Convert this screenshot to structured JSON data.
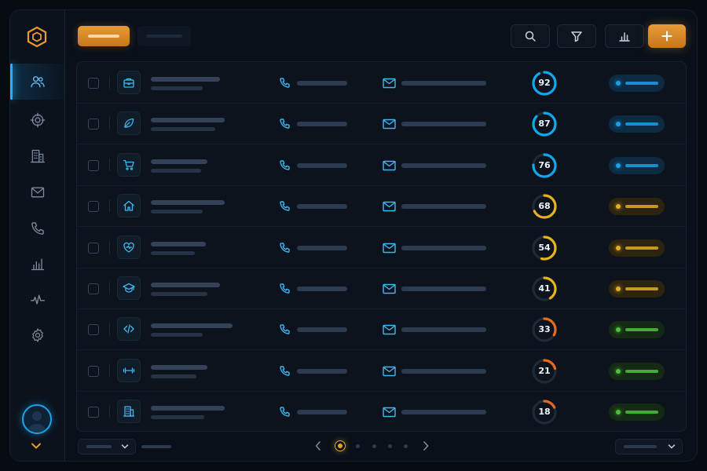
{
  "theme": {
    "accent_blue": "#22b0ff",
    "accent_orange": "#e79a34",
    "score_blue": "#12a6ec",
    "score_yellow": "#e8b21f",
    "score_orange": "#ea6a1c",
    "status_blue": "#1e9fe6",
    "status_yellow": "#e3ac2a",
    "status_green": "#4fbf40"
  },
  "sidebar": {
    "logo": "hexagon-logo-icon",
    "items": [
      {
        "icon": "users-icon",
        "active": true
      },
      {
        "icon": "target-icon",
        "active": false
      },
      {
        "icon": "building-icon",
        "active": false
      },
      {
        "icon": "mail-icon",
        "active": false
      },
      {
        "icon": "phone-icon",
        "active": false
      },
      {
        "icon": "bar-chart-icon",
        "active": false
      },
      {
        "icon": "activity-icon",
        "active": false
      },
      {
        "icon": "gear-icon",
        "active": false
      }
    ],
    "avatar": "user-avatar-icon"
  },
  "toolbar": {
    "buttons": [
      "search-icon",
      "filter-icon",
      "chart-icon"
    ],
    "add": "plus-icon"
  },
  "table": {
    "rows": [
      {
        "icon": "briefcase-icon",
        "score": 92,
        "status": "blue"
      },
      {
        "icon": "leaf-icon",
        "score": 87,
        "status": "blue"
      },
      {
        "icon": "cart-icon",
        "score": 76,
        "status": "blue"
      },
      {
        "icon": "home-icon",
        "score": 68,
        "status": "yellow"
      },
      {
        "icon": "heart-icon",
        "score": 54,
        "status": "yellow"
      },
      {
        "icon": "graduation-cap-icon",
        "score": 41,
        "status": "yellow"
      },
      {
        "icon": "code-icon",
        "score": 33,
        "status": "green"
      },
      {
        "icon": "dumbbell-icon",
        "score": 21,
        "status": "green"
      },
      {
        "icon": "office-building-icon",
        "score": 18,
        "status": "green"
      }
    ]
  },
  "pagination": {
    "current_page": 1,
    "page_count": 5
  }
}
